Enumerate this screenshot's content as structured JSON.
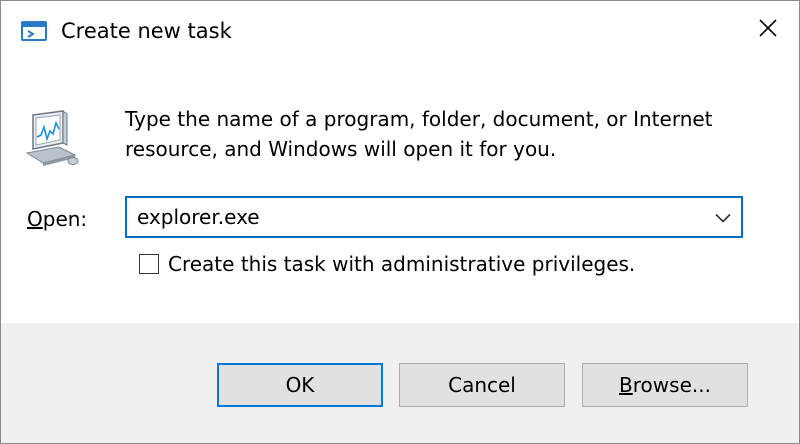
{
  "window": {
    "title": "Create new task",
    "title_icon": "run-dialog-icon",
    "close_icon": "close-icon"
  },
  "dialog": {
    "icon": "task-manager-monitor-icon",
    "description": "Type the name of a program, folder, document, or Internet resource, and Windows will open it for you.",
    "open_label_accel": "O",
    "open_label_rest": "pen:",
    "open_value": "explorer.exe",
    "dropdown_icon": "chevron-down-icon",
    "admin_checkbox_label": "Create this task with administrative privileges.",
    "admin_checked": false
  },
  "buttons": {
    "ok_label": "OK",
    "cancel_label": "Cancel",
    "browse_accel": "B",
    "browse_rest": "rowse..."
  },
  "colors": {
    "focus_border": "#0b6cc4",
    "default_button_border": "#0078d7",
    "footer_bg": "#f0f0f0",
    "button_bg": "#e1e1e1"
  }
}
